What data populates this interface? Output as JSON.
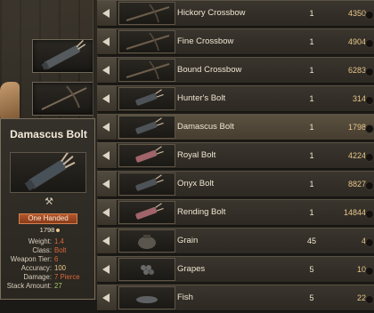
{
  "colors": {
    "accent": "#e9c68a",
    "row_bg": "#3a352d",
    "selected_row_bg": "#5b5140",
    "badge": "#b4552a",
    "good": "#a8c86a",
    "warn": "#d8693a"
  },
  "items": [
    {
      "name": "Hickory Crossbow",
      "qty": "1",
      "price": "4350",
      "icon": "crossbow-icon"
    },
    {
      "name": "Fine Crossbow",
      "qty": "1",
      "price": "4904",
      "icon": "crossbow-icon"
    },
    {
      "name": "Bound Crossbow",
      "qty": "1",
      "price": "6283",
      "icon": "crossbow-icon"
    },
    {
      "name": "Hunter's Bolt",
      "qty": "1",
      "price": "314",
      "icon": "bolt-quiver-icon"
    },
    {
      "name": "Damascus Bolt",
      "qty": "1",
      "price": "1798",
      "icon": "bolt-quiver-icon"
    },
    {
      "name": "Royal Bolt",
      "qty": "1",
      "price": "4224",
      "icon": "bolt-quiver-icon"
    },
    {
      "name": "Onyx Bolt",
      "qty": "1",
      "price": "8827",
      "icon": "bolt-quiver-icon"
    },
    {
      "name": "Rending Bolt",
      "qty": "1",
      "price": "14844",
      "icon": "bolt-quiver-icon"
    },
    {
      "name": "Grain",
      "qty": "45",
      "price": "4",
      "icon": "sack-icon"
    },
    {
      "name": "Grapes",
      "qty": "5",
      "price": "10",
      "icon": "grapes-icon"
    },
    {
      "name": "Fish",
      "qty": "5",
      "price": "22",
      "icon": "fish-icon"
    }
  ],
  "tooltip": {
    "title": "Damascus Bolt",
    "badge": "One Handed",
    "price": "1798",
    "stats": [
      {
        "label": "Weight:",
        "value": "1.4"
      },
      {
        "label": "Class:",
        "value": "Bolt"
      },
      {
        "label": "Weapon Tier:",
        "value": "6"
      },
      {
        "label": "Accuracy:",
        "value": "100"
      },
      {
        "label": "Damage:",
        "value": "7 Pierce"
      },
      {
        "label": "Stack Amount:",
        "value": "27"
      }
    ]
  }
}
